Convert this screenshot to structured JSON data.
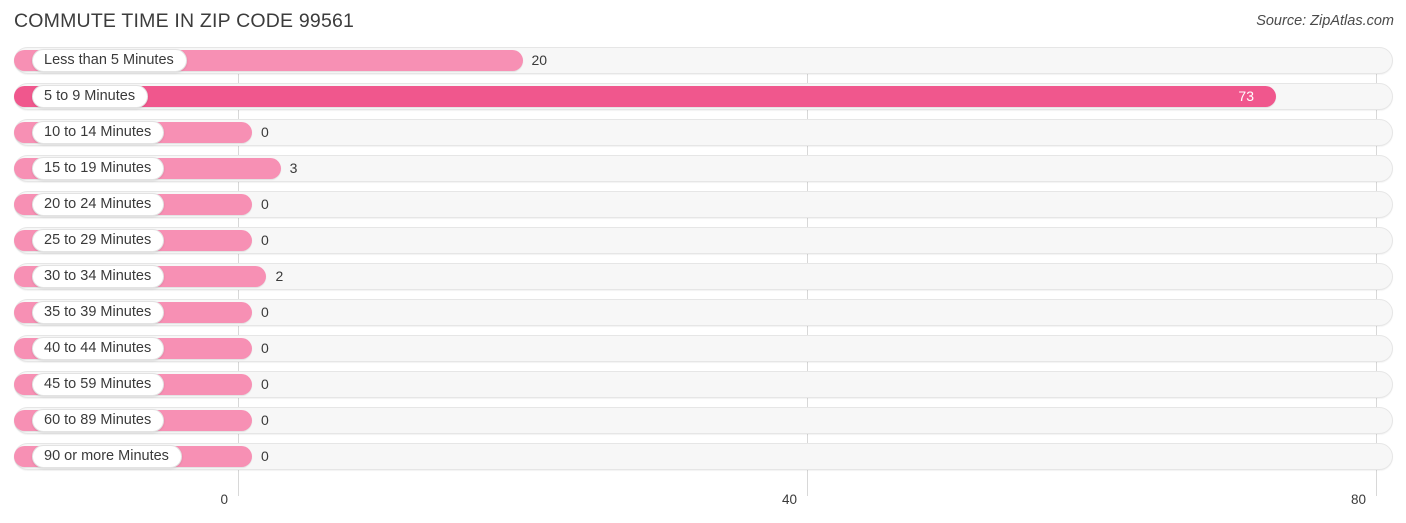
{
  "header": {
    "title": "COMMUTE TIME IN ZIP CODE 99561",
    "source": "Source: ZipAtlas.com"
  },
  "colors": {
    "bar_normal": "#f790b4",
    "bar_highlight": "#f0578d",
    "track": "#f7f7f7",
    "gridline": "#d8d8d8",
    "text": "#3a3a3a",
    "value_inside": "#ffffff"
  },
  "chart_data": {
    "type": "bar",
    "orientation": "horizontal",
    "title": "COMMUTE TIME IN ZIP CODE 99561",
    "xlabel": "",
    "ylabel": "",
    "xlim": [
      0,
      80
    ],
    "grid": true,
    "legend": false,
    "xticks": [
      0,
      40,
      80
    ],
    "xtick_labels": [
      "0",
      "40",
      "80"
    ],
    "categories": [
      "Less than 5 Minutes",
      "5 to 9 Minutes",
      "10 to 14 Minutes",
      "15 to 19 Minutes",
      "20 to 24 Minutes",
      "25 to 29 Minutes",
      "30 to 34 Minutes",
      "35 to 39 Minutes",
      "40 to 44 Minutes",
      "45 to 59 Minutes",
      "60 to 89 Minutes",
      "90 or more Minutes"
    ],
    "values": [
      20,
      73,
      0,
      3,
      0,
      0,
      2,
      0,
      0,
      0,
      0,
      0
    ],
    "value_labels": [
      "20",
      "73",
      "0",
      "3",
      "0",
      "0",
      "2",
      "0",
      "0",
      "0",
      "0",
      "0"
    ],
    "highlight_index": 1
  }
}
